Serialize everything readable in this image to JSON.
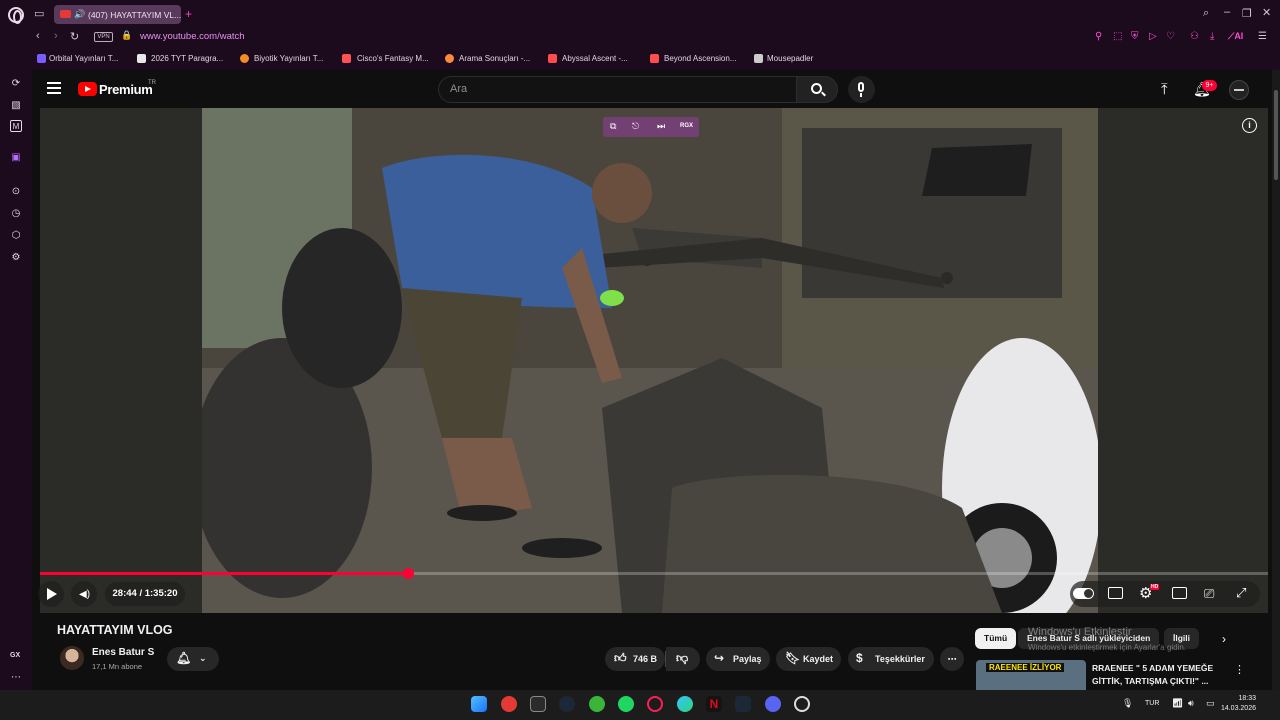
{
  "browser": {
    "tab_title": "(407) HAYATTAYIM VL...",
    "vpn_label": "VPN",
    "url": "www.youtube.com/watch",
    "gx_label": "GX",
    "bookmarks": [
      {
        "label": "Orbital Yayınları T...",
        "color": "#7a5cff"
      },
      {
        "label": "2026 TYT Paragra...",
        "color": "#e8e8e8"
      },
      {
        "label": "Biyotik Yayınları T...",
        "color": "#f48c25"
      },
      {
        "label": "Cisco's Fantasy M...",
        "color": "#ff5252"
      },
      {
        "label": "Arama Sonuçları -...",
        "color": "#ff8a3d"
      },
      {
        "label": "Abyssal Ascent -...",
        "color": "#ff4d4d"
      },
      {
        "label": "Beyond Ascension...",
        "color": "#ff4d4d"
      },
      {
        "label": "Mousepadler",
        "color": "#cccccc"
      }
    ],
    "ext_ai_label": "AI"
  },
  "youtube": {
    "logo_text": "Premium",
    "logo_region": "TR",
    "search_placeholder": "Ara",
    "notification_count": "9+",
    "player": {
      "time_current": "28:44",
      "time_total": "1:35:20",
      "time_display": "28:44 / 1:35:20",
      "progress": 0.3,
      "overlay_badge": "RGX",
      "hd_badge": "HD"
    },
    "video_title": "HAYATTAYIM VLOG",
    "channel": {
      "name": "Enes Batur S",
      "subscribers": "17,1 Mn abone"
    },
    "actions": {
      "likes": "746 B",
      "share": "Paylaş",
      "save": "Kaydet",
      "thanks": "Teşekkürler"
    },
    "chips": [
      "Tümü",
      "Enes Batur S adlı yükleyiciden",
      "İlgili"
    ],
    "recommendation": {
      "thumb_text": "RAEENEE İZLİYOR",
      "title": "RRAENEE \" 5 ADAM YEMEĞE GİTTİK, TARTIŞMA ÇIKTI!\" ..."
    },
    "watermark_line1": "Windows'u Etkinleştir",
    "watermark_line2": "Windows'u etkinleştirmek için Ayarlar'a gidin."
  },
  "taskbar": {
    "lang": "TUR",
    "time": "18:33",
    "date": "14.03.2026"
  }
}
